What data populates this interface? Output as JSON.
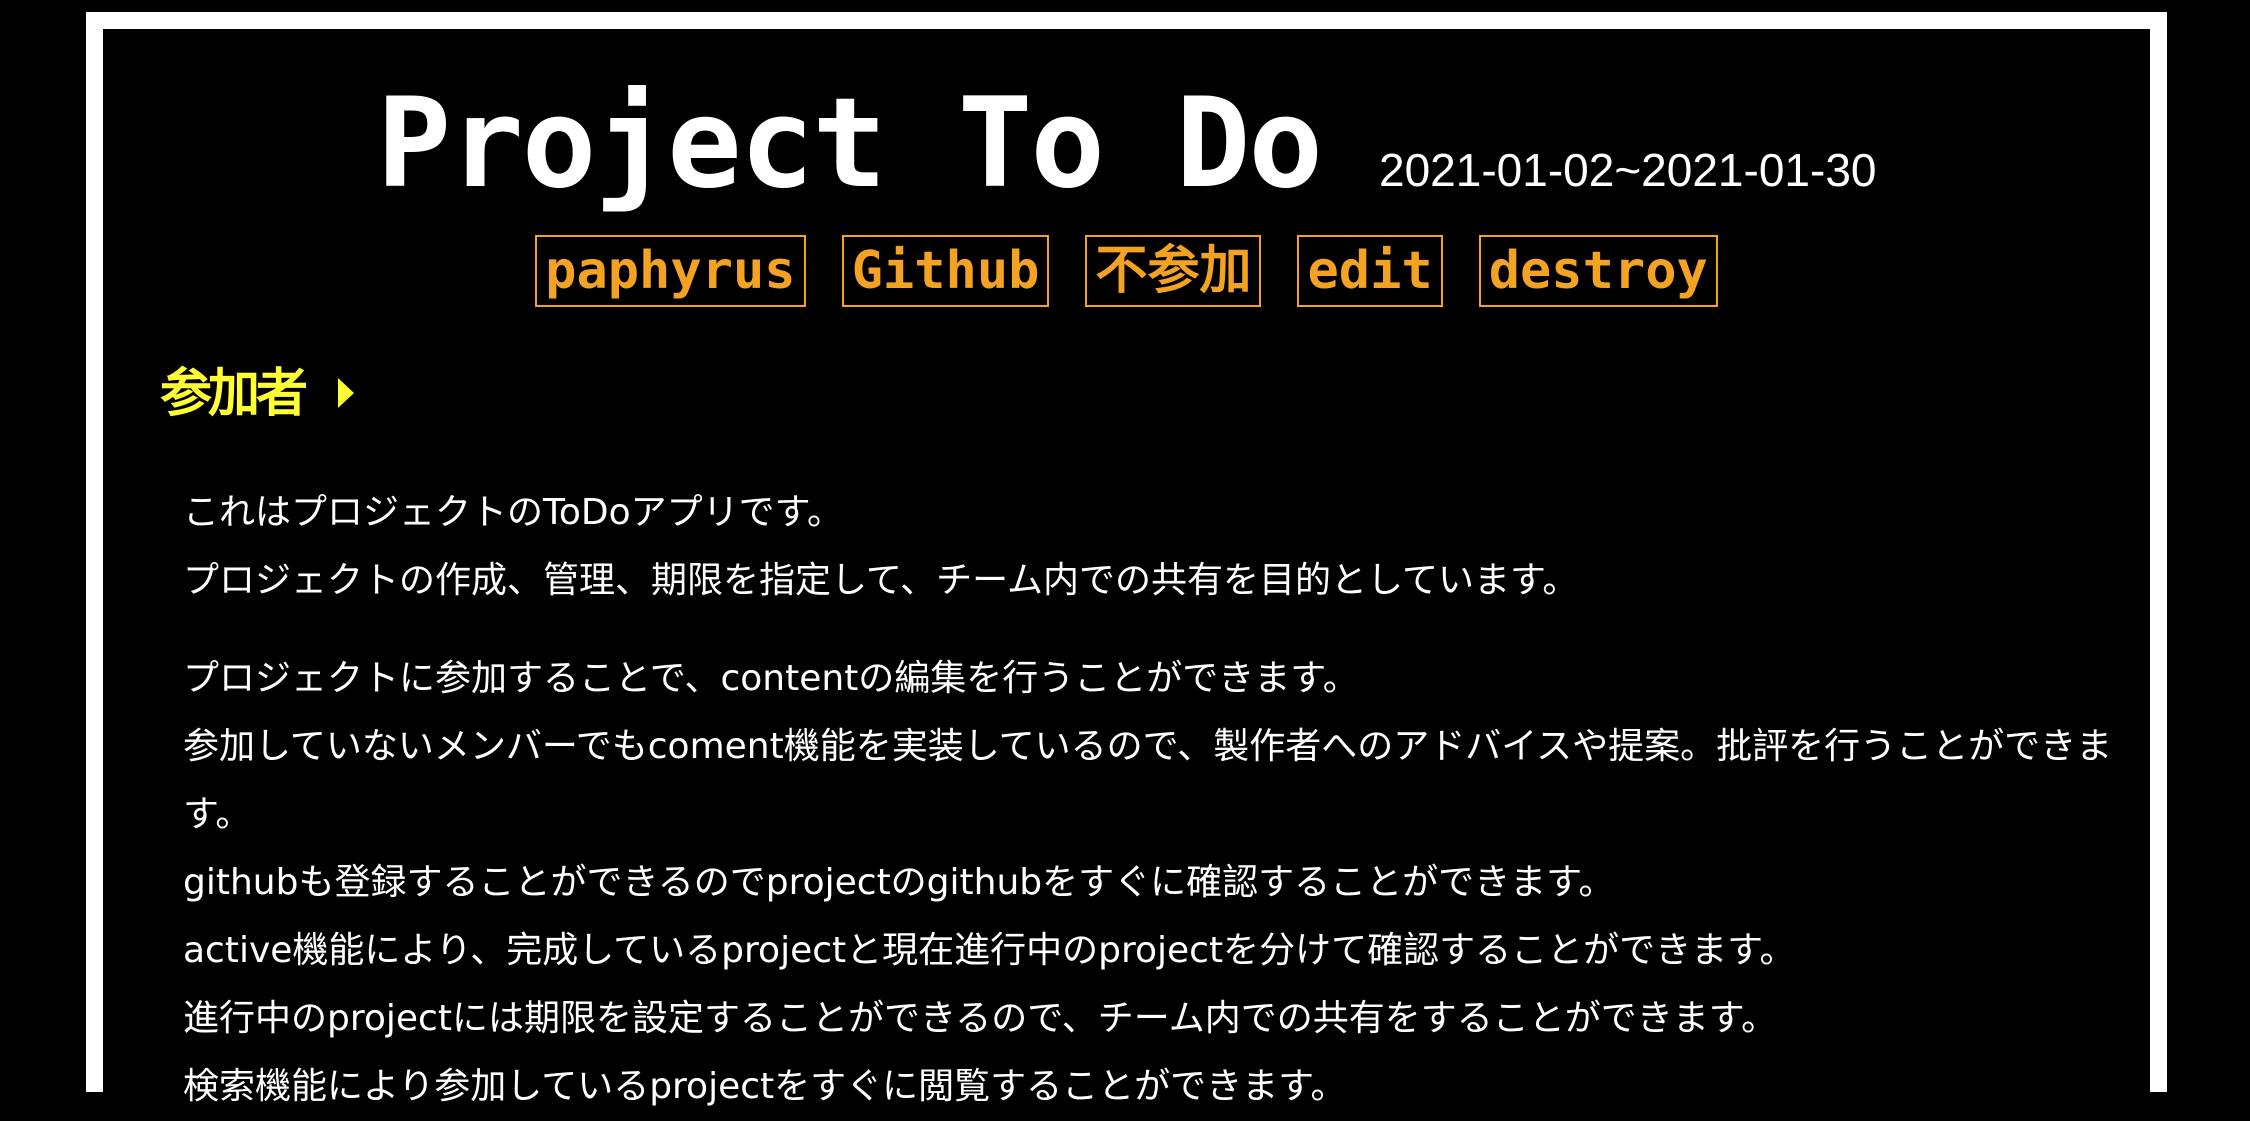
{
  "header": {
    "title": "Project To Do",
    "date_range": "2021-01-02~2021-01-30"
  },
  "buttons": [
    {
      "label": "paphyrus"
    },
    {
      "label": "Github"
    },
    {
      "label": "不参加"
    },
    {
      "label": "edit"
    },
    {
      "label": "destroy"
    }
  ],
  "participants": {
    "label": "参加者"
  },
  "colors": {
    "background": "#000000",
    "frame": "#ffffff",
    "button_accent": "#f3a321",
    "participants": "#ffff33"
  },
  "content": {
    "lines": [
      "これはプロジェクトのToDoアプリです。",
      "プロジェクトの作成、管理、期限を指定して、チーム内での共有を目的としています。",
      "プロジェクトに参加することで、contentの編集を行うことができます。",
      "参加していないメンバーでもcoment機能を実装しているので、製作者へのアドバイスや提案。批評を行うことができます。",
      "githubも登録することができるのでprojectのgithubをすぐに確認することができます。",
      "active機能により、完成しているprojectと現在進行中のprojectを分けて確認することができます。",
      "進行中のprojectには期限を設定することができるので、チーム内での共有をすることができます。",
      "検索機能により参加しているprojectをすぐに閲覧することができます。"
    ]
  }
}
